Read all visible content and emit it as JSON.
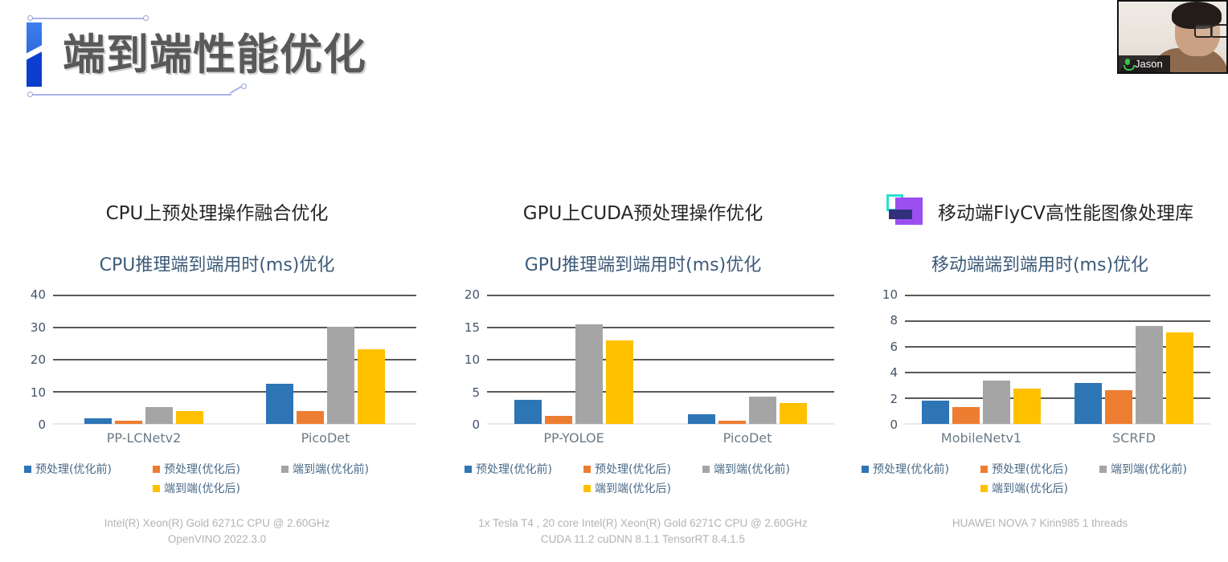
{
  "slide": {
    "title": "端到端性能优化"
  },
  "webcam": {
    "participant_name": "Jason",
    "mic_icon": "microphone-icon"
  },
  "palette": {
    "series_pre_before": "#2E75B6",
    "series_pre_after": "#ED7D31",
    "series_e2e_before": "#A5A5A5",
    "series_e2e_after": "#FFC000",
    "chart_title": "#3C5A78",
    "axis_label": "#44546A",
    "gridline": "#595959",
    "footnote": "#B3B3B3",
    "title_text": "#595959",
    "title_bar_blue": "#0C3ECB",
    "frame_line": "#AAB4E8"
  },
  "legend_labels": {
    "pre_before": "预处理(优化前)",
    "pre_after": "预处理(优化后)",
    "e2e_before": "端到端(优化前)",
    "e2e_after": "端到端(优化后)"
  },
  "columns": [
    {
      "heading": "CPU上预处理操作融合优化",
      "has_logo": false,
      "footnote_line1": "Intel(R) Xeon(R) Gold 6271C CPU @ 2.60GHz",
      "footnote_line2": "OpenVINO 2022.3.0"
    },
    {
      "heading": "GPU上CUDA预处理操作优化",
      "has_logo": false,
      "footnote_line1": "1x Tesla T4 , 20 core  Intel(R) Xeon(R) Gold 6271C CPU @ 2.60GHz",
      "footnote_line2": "CUDA 11.2 cuDNN 8.1.1 TensorRT 8.4.1.5"
    },
    {
      "heading": "移动端FlyCV高性能图像处理库",
      "has_logo": true,
      "logo_name": "flycv-logo",
      "footnote_line1": "HUAWEI NOVA 7 Kirin985 1 threads",
      "footnote_line2": ""
    }
  ],
  "chart_data": [
    {
      "type": "bar",
      "title": "CPU推理端到端用时(ms)优化",
      "xlabel": "",
      "ylabel": "",
      "ylim": [
        0,
        40
      ],
      "yticks": [
        0,
        10,
        20,
        30,
        40
      ],
      "grid": true,
      "legend_position": "bottom",
      "categories": [
        "PP-LCNetv2",
        "PicoDet"
      ],
      "series": [
        {
          "name": "预处理(优化前)",
          "color": "#2E75B6",
          "values": [
            1.8,
            12.4
          ]
        },
        {
          "name": "预处理(优化后)",
          "color": "#ED7D31",
          "values": [
            1.0,
            4.0
          ]
        },
        {
          "name": "端到端(优化前)",
          "color": "#A5A5A5",
          "values": [
            5.2,
            30.3
          ]
        },
        {
          "name": "端到端(优化后)",
          "color": "#FFC000",
          "values": [
            4.0,
            23.2
          ]
        }
      ]
    },
    {
      "type": "bar",
      "title": "GPU推理端到端用时(ms)优化",
      "xlabel": "",
      "ylabel": "",
      "ylim": [
        0,
        20
      ],
      "yticks": [
        0,
        5,
        10,
        15,
        20
      ],
      "grid": true,
      "legend_position": "bottom",
      "categories": [
        "PP-YOLOE",
        "PicoDet"
      ],
      "series": [
        {
          "name": "预处理(优化前)",
          "color": "#2E75B6",
          "values": [
            3.7,
            1.5
          ]
        },
        {
          "name": "预处理(优化后)",
          "color": "#ED7D31",
          "values": [
            1.2,
            0.5
          ]
        },
        {
          "name": "端到端(优化前)",
          "color": "#A5A5A5",
          "values": [
            15.5,
            4.2
          ]
        },
        {
          "name": "端到端(优化后)",
          "color": "#FFC000",
          "values": [
            13.0,
            3.2
          ]
        }
      ]
    },
    {
      "type": "bar",
      "title": "移动端端到端用时(ms)优化",
      "xlabel": "",
      "ylabel": "",
      "ylim": [
        0,
        10
      ],
      "yticks": [
        0,
        2,
        4,
        6,
        8,
        10
      ],
      "grid": true,
      "legend_position": "bottom",
      "categories": [
        "MobileNetv1",
        "SCRFD"
      ],
      "series": [
        {
          "name": "预处理(优化前)",
          "color": "#2E75B6",
          "values": [
            1.8,
            3.2
          ]
        },
        {
          "name": "预处理(优化后)",
          "color": "#ED7D31",
          "values": [
            1.3,
            2.65
          ]
        },
        {
          "name": "端到端(优化前)",
          "color": "#A5A5A5",
          "values": [
            3.35,
            7.6
          ]
        },
        {
          "name": "端到端(优化后)",
          "color": "#FFC000",
          "values": [
            2.75,
            7.1
          ]
        }
      ]
    }
  ]
}
